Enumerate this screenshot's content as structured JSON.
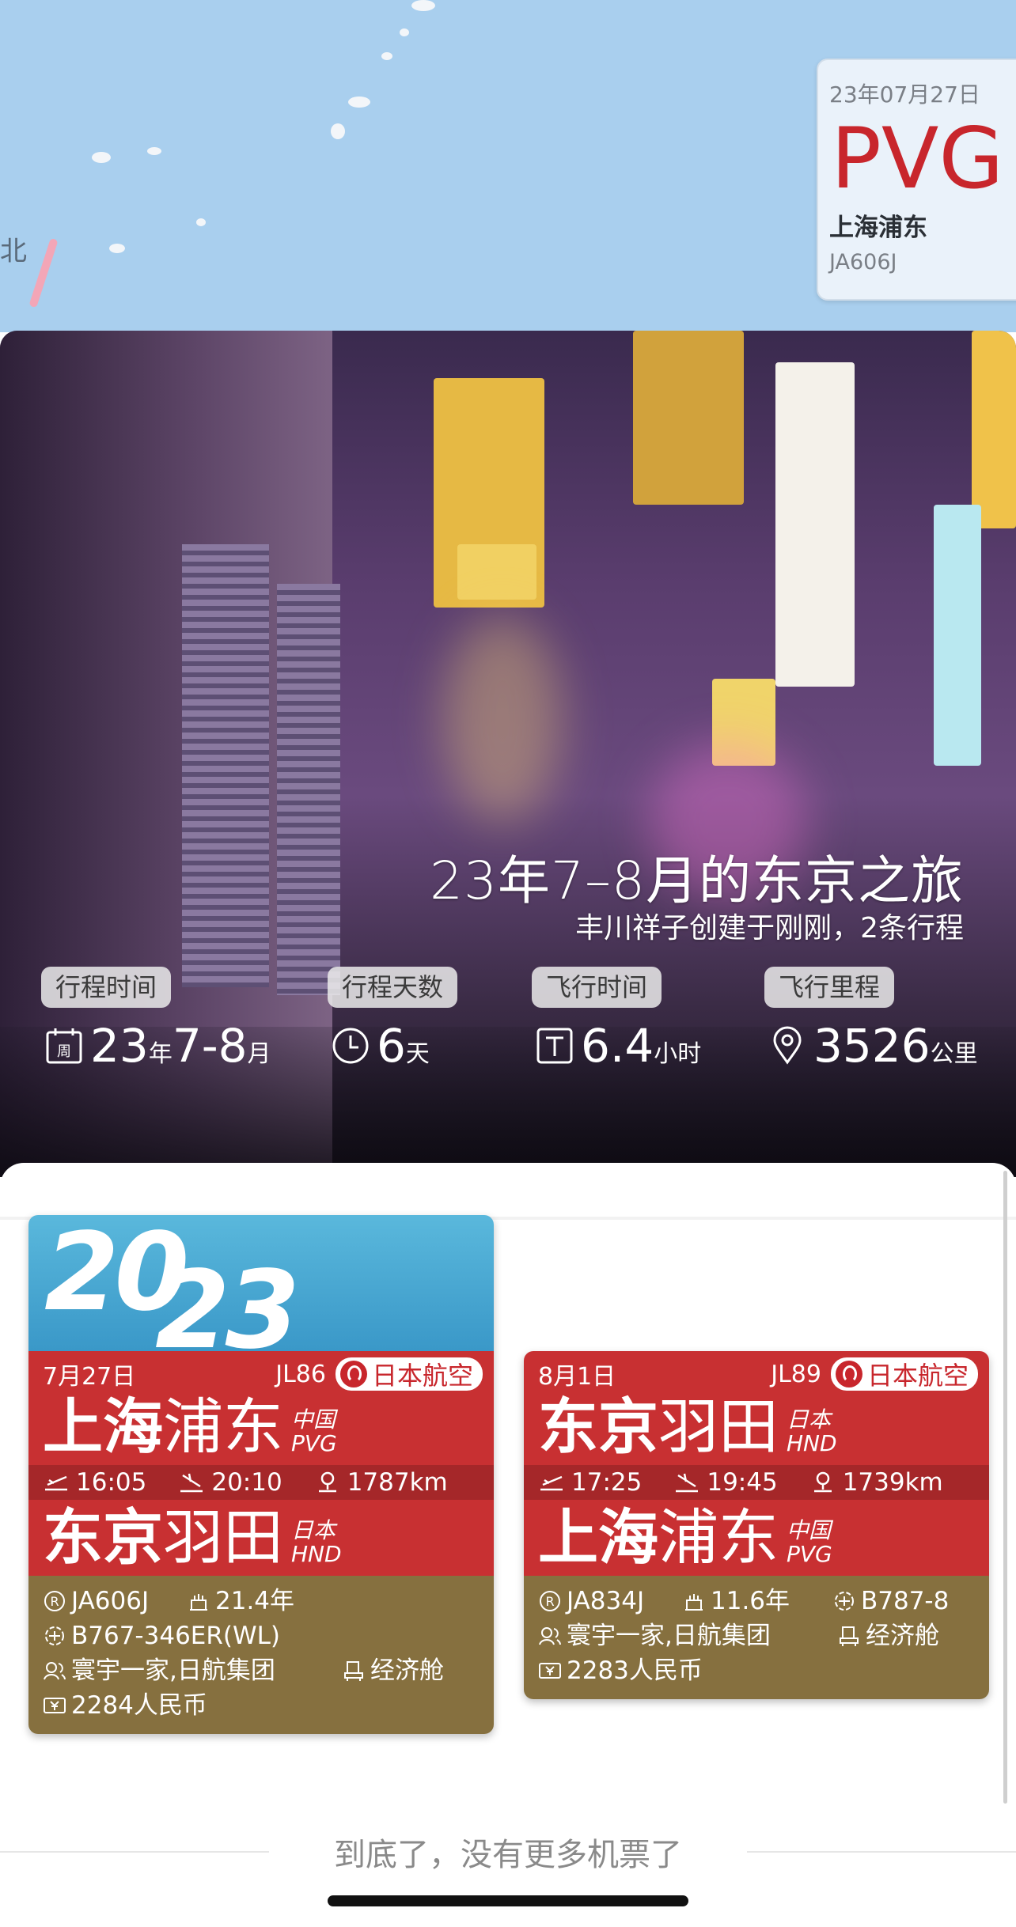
{
  "map": {
    "edge_text": "北"
  },
  "airport_card": {
    "date": "23年07月27日",
    "code": "PVG",
    "name": "上海浦东",
    "reg": "JA606J"
  },
  "trip": {
    "title": "23年7–8月的东京之旅",
    "subtitle": "丰川祥子创建于刚刚，2条行程"
  },
  "stats": [
    {
      "label": "行程时间",
      "icon": "calendar-icon",
      "icon_text": "周",
      "value": "23",
      "unit": "年",
      "value2": "7-8",
      "unit2": "月"
    },
    {
      "label": "行程天数",
      "icon": "clock-icon",
      "value": "6",
      "unit": "天"
    },
    {
      "label": "飞行时间",
      "icon": "timer-icon",
      "value": "6.4",
      "unit": "小时"
    },
    {
      "label": "飞行里程",
      "icon": "location-pin-icon",
      "value": "3526",
      "unit": "公里"
    }
  ],
  "year": {
    "part1": "20",
    "part2": "23"
  },
  "tickets": [
    {
      "date": "7月27日",
      "flight": "JL86",
      "airline": "日本航空",
      "from": {
        "a": "上海",
        "b": "浦东",
        "country": "中国",
        "code": "PVG"
      },
      "depart": "16:05",
      "arrive": "20:10",
      "distance": "1787km",
      "to": {
        "a": "东京",
        "b": "羽田",
        "country": "日本",
        "code": "HND"
      },
      "reg": "JA606J",
      "age": "21.4年",
      "aircraft": "B767-346ER(WL)",
      "group": "寰宇一家,日航集团",
      "cabin": "经济舱",
      "price": "2284人民币"
    },
    {
      "date": "8月1日",
      "flight": "JL89",
      "airline": "日本航空",
      "from": {
        "a": "东京",
        "b": "羽田",
        "country": "日本",
        "code": "HND"
      },
      "depart": "17:25",
      "arrive": "19:45",
      "distance": "1739km",
      "to": {
        "a": "上海",
        "b": "浦东",
        "country": "中国",
        "code": "PVG"
      },
      "reg": "JA834J",
      "age": "11.6年",
      "aircraft": "B787-8",
      "group": "寰宇一家,日航集团",
      "cabin": "经济舱",
      "price": "2283人民币"
    }
  ],
  "footer": {
    "end_text": "到底了，没有更多机票了"
  },
  "colors": {
    "map_water": "#a9cfee",
    "ticket_red": "#c83032",
    "ticket_olive": "#86703f",
    "accent_red": "#c8262c"
  }
}
